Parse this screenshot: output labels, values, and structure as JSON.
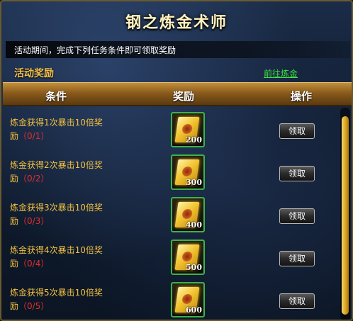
{
  "title": "钢之炼金术师",
  "description": "活动期间，完成下列任务条件即可领取奖励",
  "section_title": "活动奖励",
  "goto_link": "前往炼金",
  "table": {
    "headers": [
      "条件",
      "奖励",
      "操作"
    ],
    "rows": [
      {
        "condition": "炼金获得1次暴击10倍奖励",
        "cond_line1": "炼金获得1次暴击10倍奖",
        "cond_line2": "励",
        "progress": "（0/1）",
        "reward_amount": "200",
        "button": "领取"
      },
      {
        "condition": "炼金获得2次暴击10倍奖励",
        "cond_line1": "炼金获得2次暴击10倍奖",
        "cond_line2": "励",
        "progress": "（0/2）",
        "reward_amount": "300",
        "button": "领取"
      },
      {
        "condition": "炼金获得3次暴击10倍奖励",
        "cond_line1": "炼金获得3次暴击10倍奖",
        "cond_line2": "励",
        "progress": "（0/3）",
        "reward_amount": "400",
        "button": "领取"
      },
      {
        "condition": "炼金获得4次暴击10倍奖励",
        "cond_line1": "炼金获得4次暴击10倍奖",
        "cond_line2": "励",
        "progress": "（0/4）",
        "reward_amount": "500",
        "button": "领取"
      },
      {
        "condition": "炼金获得5次暴击10倍奖励",
        "cond_line1": "炼金获得5次暴击10倍奖",
        "cond_line2": "励",
        "progress": "（0/5）",
        "reward_amount": "600",
        "button": "领取"
      }
    ]
  },
  "colors": {
    "accent_gold": "#f2c04a",
    "link_green": "#3fe040",
    "progress_red": "#e03030",
    "reward_border_green": "#3bb34a"
  },
  "icons": {
    "reward": "gold-ticket-icon"
  }
}
